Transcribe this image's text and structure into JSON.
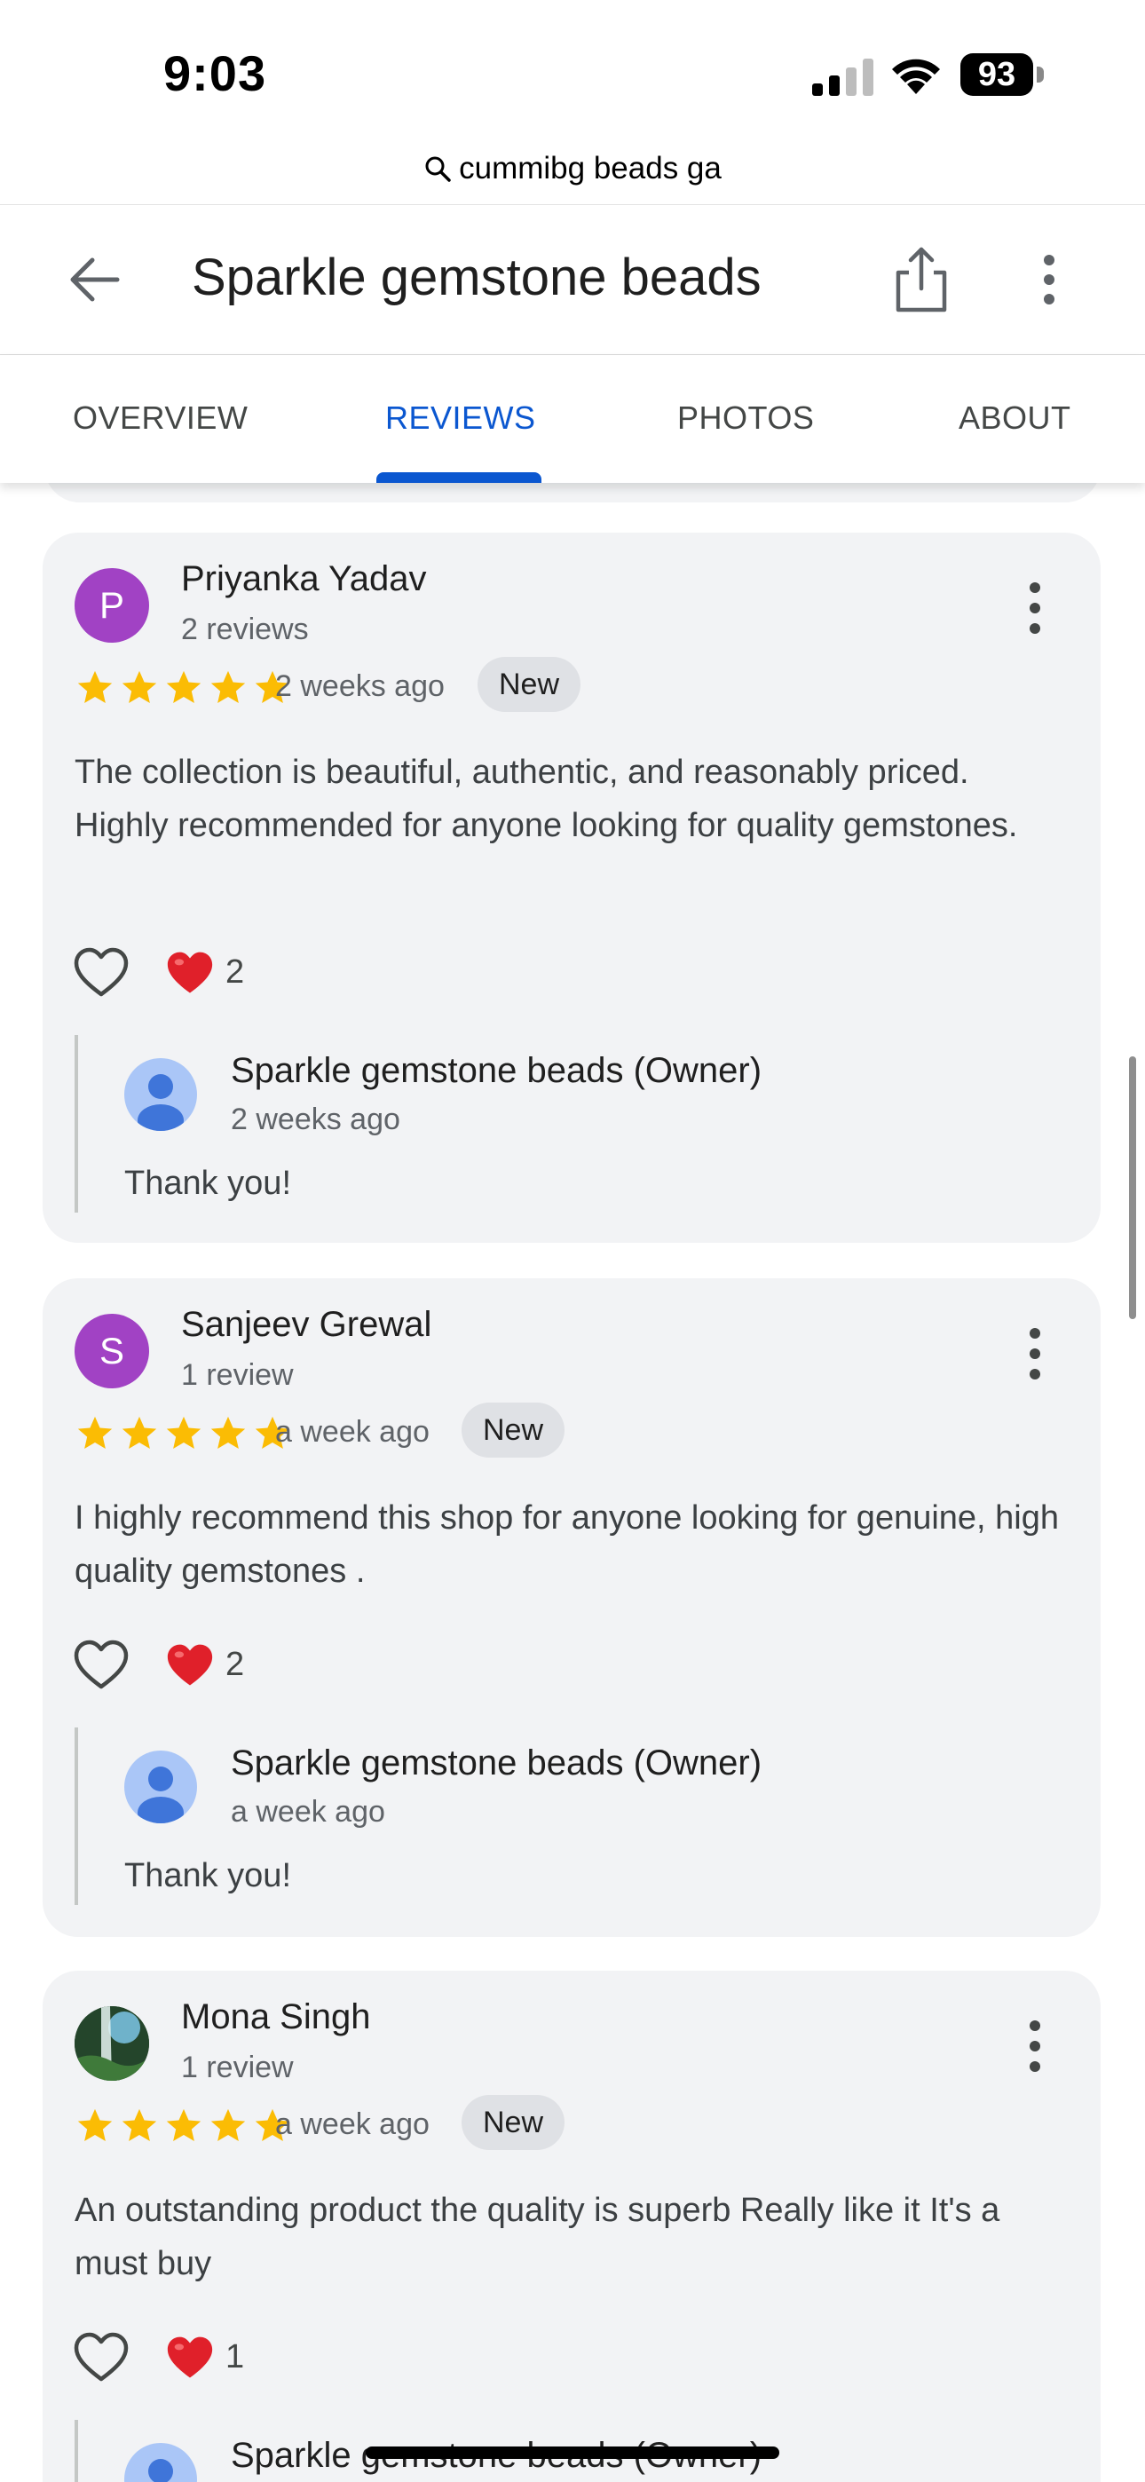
{
  "status_bar": {
    "time": "9:03",
    "battery": "93"
  },
  "url_bar": {
    "text": "cummibg beads ga"
  },
  "header": {
    "title": "Sparkle gemstone beads"
  },
  "tabs": [
    {
      "label": "OVERVIEW"
    },
    {
      "label": "REVIEWS",
      "active": true
    },
    {
      "label": "PHOTOS"
    },
    {
      "label": "ABOUT"
    }
  ],
  "colors": {
    "accent": "#0b57d0",
    "star": "#fbbc04",
    "avatar_purple": "#a142c4",
    "card_bg": "#f2f3f5"
  },
  "reviews": [
    {
      "avatar_letter": "P",
      "name": "Priyanka Yadav",
      "meta": "2 reviews",
      "rating": 5,
      "date": "2 weeks ago",
      "badge": "New",
      "text": "The collection is beautiful, authentic, and reasonably priced. Highly recommended for anyone looking for quality gemstones.",
      "heart_count": "2",
      "owner": {
        "name": "Sparkle gemstone beads (Owner)",
        "date": "2 weeks ago",
        "text": "Thank you!"
      }
    },
    {
      "avatar_letter": "S",
      "name": "Sanjeev Grewal",
      "meta": "1 review",
      "rating": 5,
      "date": "a week ago",
      "badge": "New",
      "text": "I highly recommend this shop for anyone looking for genuine, high quality gemstones .",
      "heart_count": "2",
      "owner": {
        "name": "Sparkle gemstone beads (Owner)",
        "date": "a week ago",
        "text": "Thank you!"
      }
    },
    {
      "avatar_letter": "",
      "name": "Mona Singh",
      "meta": "1 review",
      "rating": 5,
      "date": "a week ago",
      "badge": "New",
      "text": "An outstanding product the quality is superb Really like it It's a must buy",
      "heart_count": "1",
      "owner": {
        "name": "Sparkle gemstone beads (Owner)"
      }
    }
  ]
}
